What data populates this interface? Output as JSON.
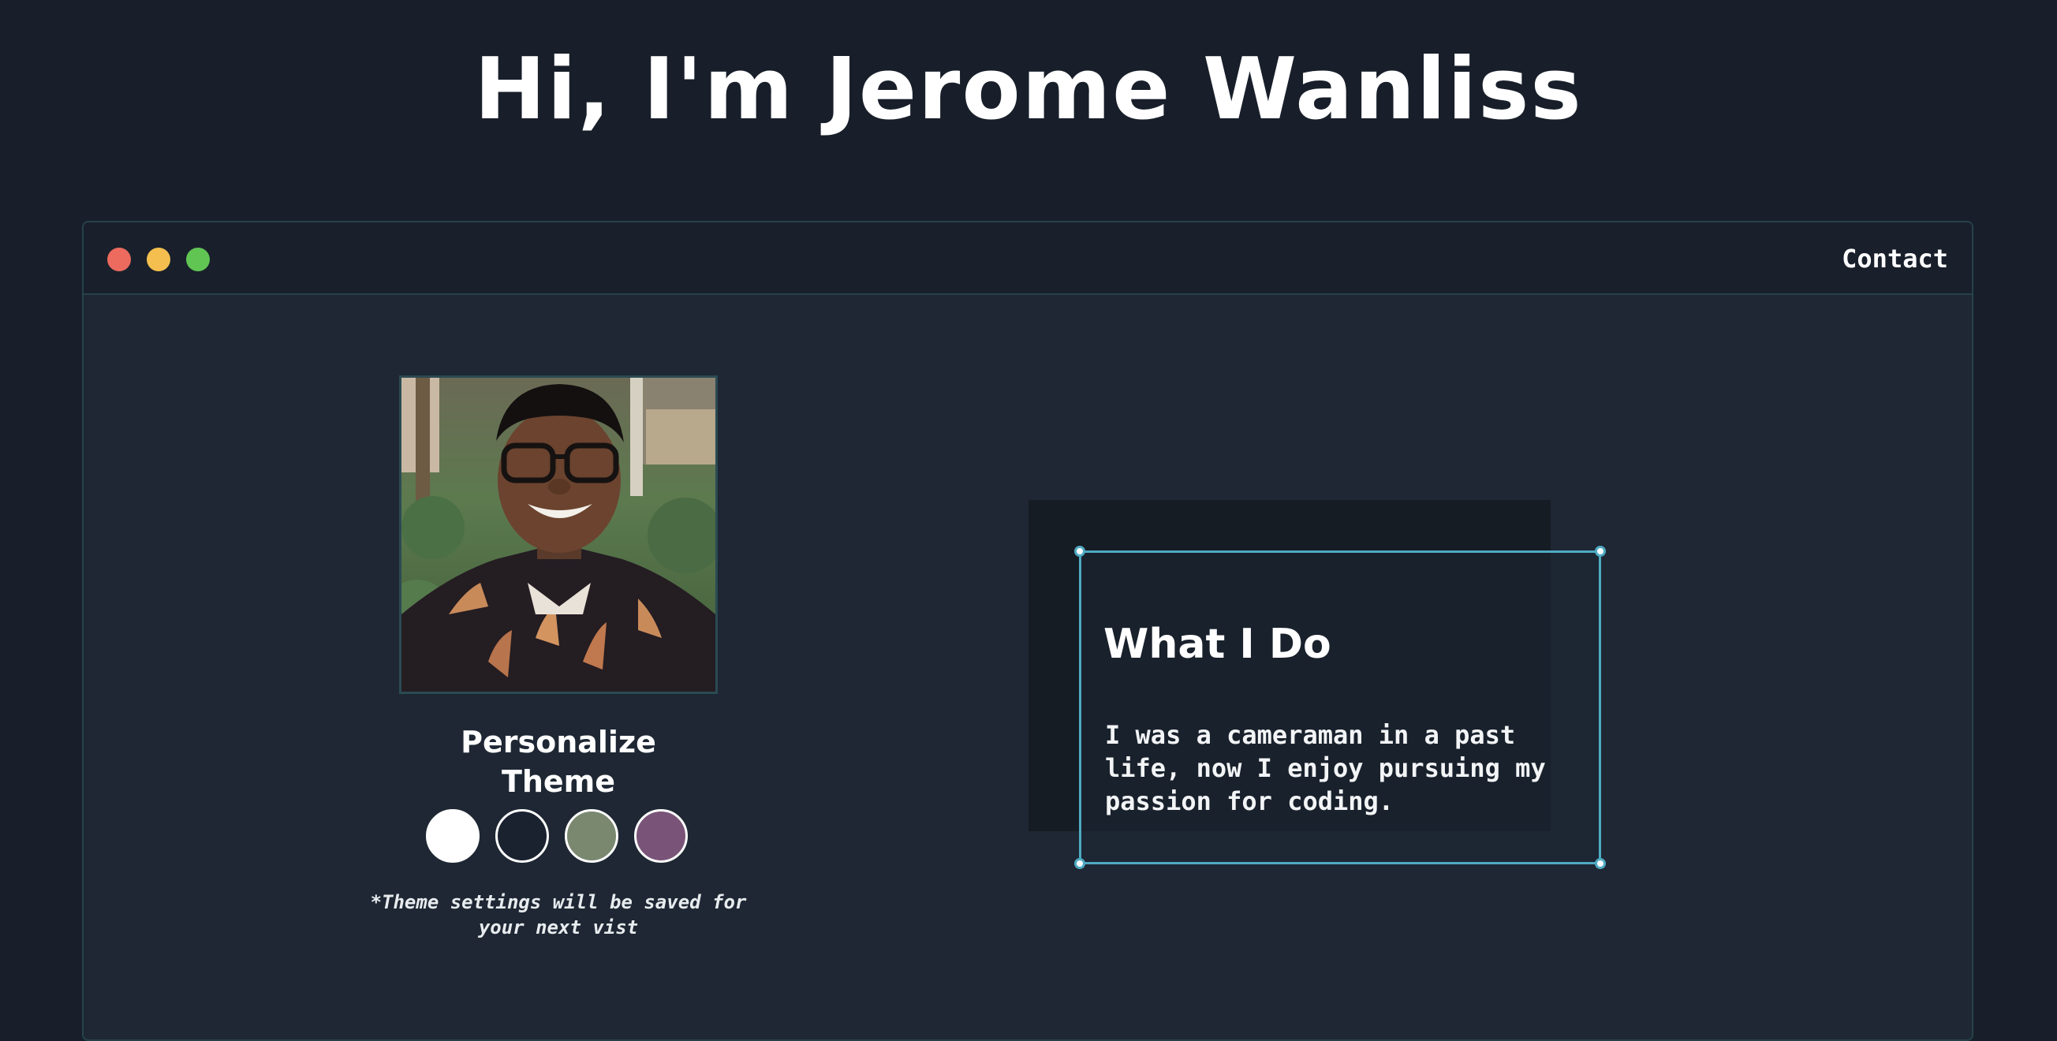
{
  "header": {
    "title": "Hi, I'm Jerome Wanliss"
  },
  "window": {
    "controls": [
      "close",
      "minimize",
      "maximize"
    ],
    "nav": {
      "contact_label": "Contact"
    }
  },
  "profile": {
    "photo_alt": "Jerome Wanliss"
  },
  "theme": {
    "heading": "Personalize Theme",
    "swatches": [
      {
        "name": "white",
        "color": "#ffffff"
      },
      {
        "name": "dark",
        "color": "#1a2230"
      },
      {
        "name": "sage",
        "color": "#7a8870"
      },
      {
        "name": "plum",
        "color": "#7a5478"
      }
    ],
    "note": "*Theme settings will be saved for your next vist"
  },
  "about": {
    "title": "What I Do",
    "body": "I was a cameraman in a past life, now I enjoy pursuing my passion for coding."
  },
  "colors": {
    "background": "#181f2a",
    "window": "#1e2733",
    "accent": "#4eaac2"
  }
}
